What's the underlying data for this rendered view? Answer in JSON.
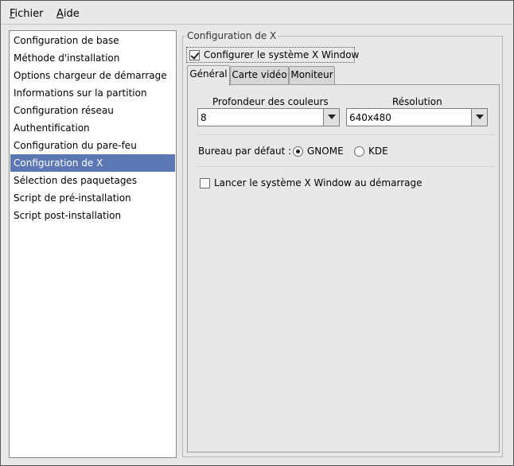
{
  "menu": {
    "items": [
      {
        "mnemonic": "F",
        "rest": "ichier"
      },
      {
        "mnemonic": "A",
        "rest": "ide"
      }
    ]
  },
  "sidebar": {
    "items": [
      {
        "label": "Configuration de base"
      },
      {
        "label": "Méthode d'installation"
      },
      {
        "label": "Options chargeur de démarrage"
      },
      {
        "label": "Informations sur la partition"
      },
      {
        "label": "Configuration réseau"
      },
      {
        "label": "Authentification"
      },
      {
        "label": "Configuration du pare-feu"
      },
      {
        "label": "Configuration de X"
      },
      {
        "label": "Sélection des paquetages"
      },
      {
        "label": "Script de pré-installation"
      },
      {
        "label": "Script post-installation"
      }
    ],
    "selected": "Configuration de X"
  },
  "section": {
    "title": "Configuration de X",
    "configure_label": "Configurer le système X Window",
    "configure_checked": true
  },
  "tabs": {
    "items": [
      {
        "label": "Général"
      },
      {
        "label": "Carte vidéo"
      },
      {
        "label": "Moniteur"
      }
    ],
    "active": "Général"
  },
  "general": {
    "color_depth": {
      "label": "Profondeur des couleurs",
      "value": "8"
    },
    "resolution": {
      "label": "Résolution",
      "value": "640x480"
    },
    "desktop": {
      "label": "Bureau par défaut :",
      "options": [
        {
          "label": "GNOME",
          "checked": true
        },
        {
          "label": "KDE",
          "checked": false
        }
      ]
    },
    "startx": {
      "label": "Lancer le système X Window au démarrage",
      "checked": false
    }
  },
  "colors": {
    "selection": "#5c78b4",
    "window_bg": "#e8e8e8"
  }
}
